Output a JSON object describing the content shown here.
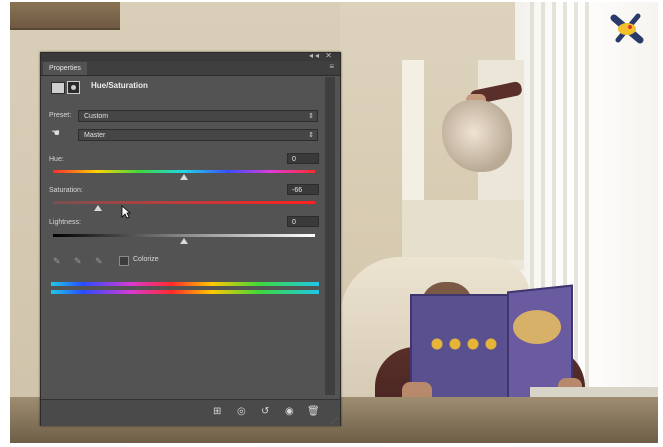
{
  "panel": {
    "tab_label": "Properties",
    "window_controls": "◂◂ ✕",
    "tab_menu": "≡",
    "adjustment_title": "Hue/Saturation",
    "preset_label": "Preset:",
    "preset_value": "Custom",
    "channel_value": "Master",
    "hue_label": "Hue:",
    "hue_value": "0",
    "hue_level": 0,
    "saturation_label": "Saturation:",
    "saturation_value": "-66",
    "saturation_level": -66,
    "lightness_label": "Lightness:",
    "lightness_value": "0",
    "lightness_level": 0,
    "colorize_label": "Colorize",
    "colorize_checked": false
  },
  "icons": {
    "adjustment": "hue-saturation-icon",
    "mask": "mask-icon",
    "on_image_adjust": "hand-icon",
    "eyedroppers": [
      "eyedropper-icon",
      "eyedropper-plus-icon",
      "eyedropper-minus-icon"
    ],
    "bottom_toolbar": [
      "clip-to-layer-icon",
      "view-previous-icon",
      "reset-icon",
      "visibility-icon",
      "delete-icon"
    ]
  }
}
